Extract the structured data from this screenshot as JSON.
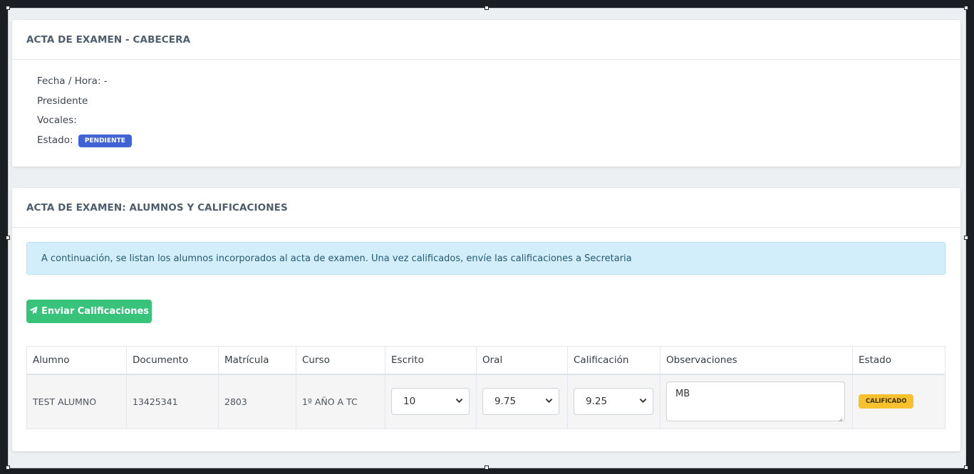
{
  "cabecera": {
    "title": "ACTA DE EXAMEN - CABECERA",
    "fecha_hora": "Fecha / Hora: -",
    "presidente": "Presidente",
    "vocales": "Vocales:",
    "estado_label": "Estado:",
    "estado_badge": "PENDIENTE"
  },
  "alumnos": {
    "title": "ACTA DE EXAMEN: ALUMNOS Y CALIFICACIONES",
    "alert": "A continuación, se listan los alumnos incorporados al acta de examen. Una vez calificados, envíe las calificaciones a Secretaria",
    "send_button": "Enviar Calificaciones",
    "columns": [
      "Alumno",
      "Documento",
      "Matrícula",
      "Curso",
      "Escrito",
      "Oral",
      "Calificación",
      "Observaciones",
      "Estado"
    ],
    "rows": [
      {
        "alumno": "TEST ALUMNO",
        "documento": "13425341",
        "matricula": "2803",
        "curso": "1º AÑO A TC",
        "escrito": "10",
        "oral": "9.75",
        "calificacion": "9.25",
        "observaciones": "MB",
        "estado": "CALIFICADO"
      }
    ]
  },
  "colors": {
    "pendiente": "#3f63d4",
    "calificado": "#f7c02d",
    "send_button": "#38c37a",
    "alert_bg": "#d3eefb"
  }
}
